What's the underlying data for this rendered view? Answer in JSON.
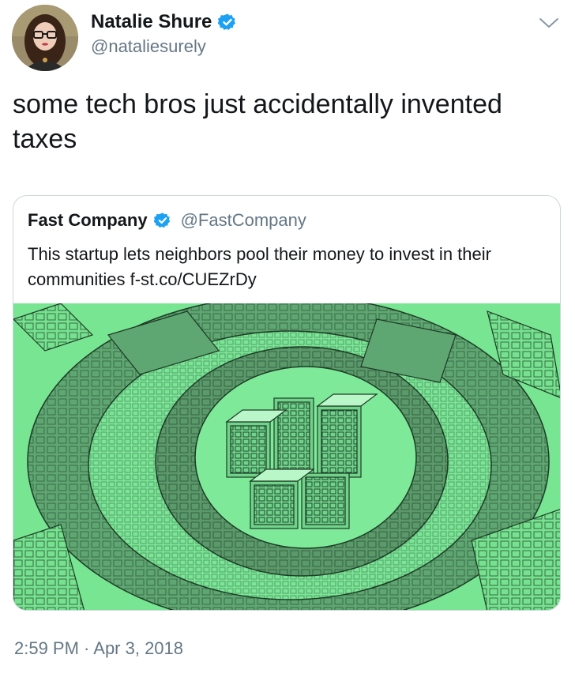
{
  "author": {
    "name": "Natalie Shure",
    "handle": "@nataliesurely",
    "verified": true
  },
  "tweet": {
    "text": "some tech bros just accidentally invented taxes"
  },
  "quoted_tweet": {
    "name": "Fast Company",
    "handle": "@FastCompany",
    "verified": true,
    "text": "This startup lets neighbors pool their money to invest in their communities f-st.co/CUEZrDy"
  },
  "timestamp": "2:59 PM · Apr 3, 2018",
  "colors": {
    "verified_blue": "#1da1f2",
    "secondary_text": "#657786",
    "image_green": "#77e591",
    "image_dark_green": "#4f8a5e"
  },
  "icons": {
    "menu": "chevron-down-icon",
    "verified": "verified-badge-icon"
  }
}
